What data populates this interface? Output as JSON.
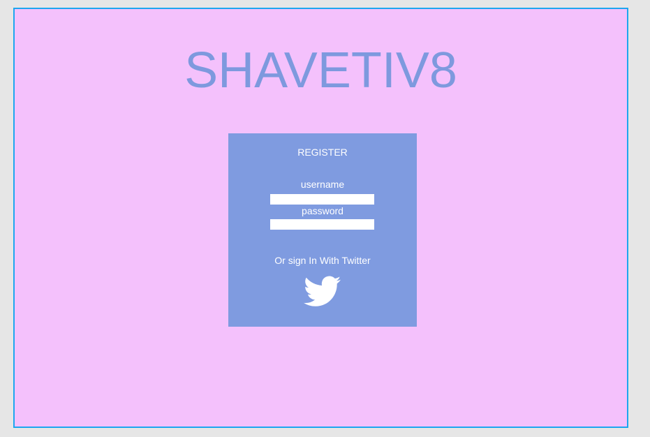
{
  "app": {
    "title": "SHAVETIV8"
  },
  "register_card": {
    "title": "REGISTER",
    "username_label": "username",
    "username_value": "",
    "password_label": "password",
    "password_value": "",
    "twitter_text": "Or sign In With Twitter",
    "twitter_icon": "twitter-bird-icon"
  },
  "colors": {
    "page_background": "#e6e6e6",
    "frame_background": "#f4c1fc",
    "frame_border": "#1ea6ef",
    "accent": "#7e99de",
    "text_on_card": "#ffffff"
  }
}
